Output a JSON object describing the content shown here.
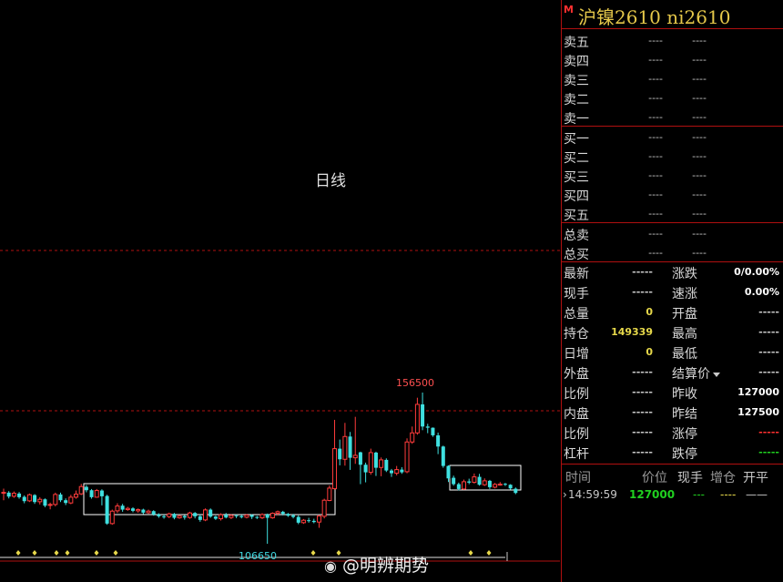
{
  "chart": {
    "period_label": "日线",
    "high_label": "156500",
    "low_label": "106650",
    "watermark": "@明辨期势",
    "colors": {
      "up": "#ff3c3c",
      "down": "#3fe0e0",
      "dashed": "#b01010",
      "box": "#ffffff",
      "marker": "#e6d84a"
    },
    "markers": 10
  },
  "chart_data": {
    "type": "candlestick",
    "title": "",
    "xlabel": "",
    "ylabel": "",
    "ylim": [
      100000,
      160000
    ],
    "high_annotation": 156500,
    "low_annotation": 106650,
    "candles": [
      [
        123400,
        123600,
        121000,
        124800
      ],
      [
        123500,
        122200,
        121600,
        124000
      ],
      [
        122300,
        123300,
        121800,
        123900
      ],
      [
        123200,
        122000,
        121500,
        123700
      ],
      [
        122100,
        120700,
        120000,
        122600
      ],
      [
        120800,
        122800,
        120400,
        123200
      ],
      [
        122700,
        120400,
        119800,
        123000
      ],
      [
        120500,
        121300,
        119600,
        122000
      ],
      [
        121300,
        119200,
        118700,
        121600
      ],
      [
        119300,
        119600,
        118000,
        120200
      ],
      [
        119600,
        122900,
        119000,
        123500
      ],
      [
        122900,
        121000,
        120400,
        123500
      ],
      [
        121000,
        120100,
        119400,
        121600
      ],
      [
        120100,
        122000,
        119700,
        122800
      ],
      [
        122000,
        123000,
        121500,
        124200
      ],
      [
        123100,
        125500,
        122700,
        126400
      ],
      [
        125400,
        124300,
        123600,
        126000
      ],
      [
        124300,
        122000,
        121500,
        124700
      ],
      [
        122000,
        124200,
        121800,
        124700
      ],
      [
        124200,
        122300,
        119300,
        124600
      ],
      [
        122400,
        113300,
        112900,
        122800
      ],
      [
        113300,
        117400,
        112900,
        117900
      ],
      [
        117500,
        119100,
        116800,
        120000
      ],
      [
        119200,
        117900,
        117200,
        119800
      ],
      [
        117900,
        118300,
        117500,
        118800
      ],
      [
        118300,
        117500,
        117000,
        118700
      ],
      [
        117500,
        117900,
        116900,
        118300
      ],
      [
        117900,
        116900,
        116400,
        118200
      ],
      [
        116900,
        117400,
        116500,
        117900
      ],
      [
        117400,
        116300,
        115900,
        117700
      ],
      [
        116300,
        115700,
        115200,
        116700
      ],
      [
        115700,
        115600,
        114900,
        116300
      ],
      [
        115600,
        116500,
        115100,
        116900
      ],
      [
        116500,
        115200,
        114700,
        116800
      ],
      [
        115200,
        115800,
        114900,
        116200
      ],
      [
        115800,
        115300,
        114600,
        116100
      ],
      [
        115300,
        116800,
        114900,
        117200
      ],
      [
        116800,
        115700,
        115000,
        117100
      ],
      [
        115700,
        114500,
        113900,
        116300
      ],
      [
        114500,
        117800,
        114100,
        118300
      ],
      [
        117900,
        115600,
        115200,
        118300
      ],
      [
        115600,
        114900,
        114500,
        115900
      ],
      [
        114900,
        116200,
        114300,
        116700
      ],
      [
        116200,
        115300,
        115000,
        116800
      ],
      [
        115300,
        116000,
        114800,
        116400
      ],
      [
        116000,
        115800,
        115100,
        116300
      ],
      [
        115800,
        115400,
        115000,
        116200
      ],
      [
        115400,
        116100,
        115000,
        116400
      ],
      [
        116100,
        115500,
        114800,
        116400
      ],
      [
        115500,
        115200,
        114800,
        115800
      ],
      [
        115200,
        116300,
        114800,
        116700
      ],
      [
        116300,
        115200,
        106650,
        116600
      ],
      [
        115200,
        116700,
        114900,
        117000
      ],
      [
        116700,
        117200,
        116000,
        117600
      ],
      [
        117200,
        116500,
        116000,
        117500
      ],
      [
        116500,
        115900,
        115500,
        116800
      ],
      [
        116000,
        115500,
        115000,
        116500
      ],
      [
        115500,
        113600,
        113100,
        116000
      ],
      [
        113600,
        114400,
        113200,
        114800
      ],
      [
        114400,
        114200,
        113600,
        115200
      ],
      [
        114200,
        113800,
        113400,
        114900
      ],
      [
        113800,
        115800,
        111900,
        116200
      ],
      [
        115700,
        121000,
        115000,
        121500
      ],
      [
        120900,
        125000,
        120700,
        125900
      ],
      [
        124800,
        138000,
        124500,
        147500
      ],
      [
        138000,
        134500,
        132500,
        141000
      ],
      [
        134500,
        142000,
        132400,
        146500
      ],
      [
        142000,
        135000,
        131000,
        143500
      ],
      [
        135000,
        135800,
        133000,
        148500
      ],
      [
        136800,
        132700,
        126300,
        137000
      ],
      [
        132700,
        130200,
        126900,
        133400
      ],
      [
        130200,
        136700,
        129400,
        138000
      ],
      [
        136700,
        131700,
        129000,
        137000
      ],
      [
        131800,
        134300,
        128900,
        135100
      ],
      [
        134300,
        130800,
        130300,
        134800
      ],
      [
        130800,
        129900,
        128700,
        131300
      ],
      [
        129900,
        131100,
        129200,
        132300
      ],
      [
        131100,
        130200,
        129700,
        131900
      ],
      [
        130400,
        140200,
        129900,
        141400
      ],
      [
        140200,
        143200,
        139600,
        145300
      ],
      [
        143200,
        152600,
        142600,
        154800
      ],
      [
        152600,
        145300,
        144100,
        156500
      ],
      [
        145300,
        144900,
        143100,
        146200
      ],
      [
        144900,
        142400,
        141900,
        145000
      ],
      [
        142400,
        138700,
        136200,
        143300
      ],
      [
        138700,
        132300,
        131700,
        139000
      ],
      [
        132300,
        128200,
        127000,
        132500
      ],
      [
        128400,
        126300,
        125800,
        129100
      ],
      [
        126300,
        124700,
        124200,
        126800
      ],
      [
        124700,
        127100,
        124400,
        127800
      ],
      [
        127200,
        126800,
        126300,
        128100
      ],
      [
        126900,
        128700,
        126500,
        129800
      ],
      [
        128700,
        126100,
        125800,
        129700
      ],
      [
        126100,
        127400,
        125700,
        128200
      ],
      [
        127400,
        125300,
        124700,
        127700
      ],
      [
        125300,
        126200,
        124900,
        126700
      ],
      [
        126200,
        126300,
        125800,
        127000
      ],
      [
        126400,
        126100,
        125700,
        126700
      ],
      [
        126100,
        124900,
        124500,
        126300
      ],
      [
        124800,
        123400,
        123000,
        125200
      ]
    ]
  },
  "quote": {
    "title_mark": "M",
    "title": "沪镍2610  ni2610",
    "asks": [
      {
        "label": "卖五",
        "price": "----",
        "vol": "----"
      },
      {
        "label": "卖四",
        "price": "----",
        "vol": "----"
      },
      {
        "label": "卖三",
        "price": "----",
        "vol": "----"
      },
      {
        "label": "卖二",
        "price": "----",
        "vol": "----"
      },
      {
        "label": "卖一",
        "price": "----",
        "vol": "----"
      }
    ],
    "bids": [
      {
        "label": "买一",
        "price": "----",
        "vol": "----"
      },
      {
        "label": "买二",
        "price": "----",
        "vol": "----"
      },
      {
        "label": "买三",
        "price": "----",
        "vol": "----"
      },
      {
        "label": "买四",
        "price": "----",
        "vol": "----"
      },
      {
        "label": "买五",
        "price": "----",
        "vol": "----"
      }
    ],
    "totals": [
      {
        "label": "总卖",
        "price": "----",
        "vol": "----"
      },
      {
        "label": "总买",
        "price": "----",
        "vol": "----"
      }
    ],
    "left": [
      {
        "label": "最新",
        "value": "-----",
        "cls": "dash"
      },
      {
        "label": "现手",
        "value": "-----",
        "cls": "dash"
      },
      {
        "label": "总量",
        "value": "0",
        "cls": "yellow"
      },
      {
        "label": "持仓",
        "value": "149339",
        "cls": "yellow"
      },
      {
        "label": "日增",
        "value": "0",
        "cls": "yellow"
      },
      {
        "label": "外盘",
        "value": "-----",
        "cls": "dash"
      },
      {
        "label": "比例",
        "value": "-----",
        "cls": "dash"
      },
      {
        "label": "内盘",
        "value": "-----",
        "cls": "dash"
      },
      {
        "label": "比例",
        "value": "-----",
        "cls": "dash"
      },
      {
        "label": "杠杆",
        "value": "-----",
        "cls": "dash"
      }
    ],
    "right": [
      {
        "label": "涨跌",
        "value": "0/0.00%",
        "cls": "white"
      },
      {
        "label": "速涨",
        "value": "0.00%",
        "cls": "white"
      },
      {
        "label": "开盘",
        "value": "-----",
        "cls": "dash"
      },
      {
        "label": "最高",
        "value": "-----",
        "cls": "dash"
      },
      {
        "label": "最低",
        "value": "-----",
        "cls": "dash"
      },
      {
        "label": "结算价",
        "value": "-----",
        "cls": "dash"
      },
      {
        "label": "昨收",
        "value": "127000",
        "cls": "white"
      },
      {
        "label": "昨结",
        "value": "127500",
        "cls": "white"
      },
      {
        "label": "涨停",
        "value": "-----",
        "cls": "red"
      },
      {
        "label": "跌停",
        "value": "-----",
        "cls": "green"
      }
    ],
    "trades_header": {
      "time": "时间",
      "price": "价位",
      "vol": "现手",
      "oi": "增仓",
      "flag": "开平"
    },
    "trades": [
      {
        "time": "14:59:59",
        "price": "127000",
        "vol": "---",
        "oi": "----",
        "flag": "——"
      }
    ]
  }
}
